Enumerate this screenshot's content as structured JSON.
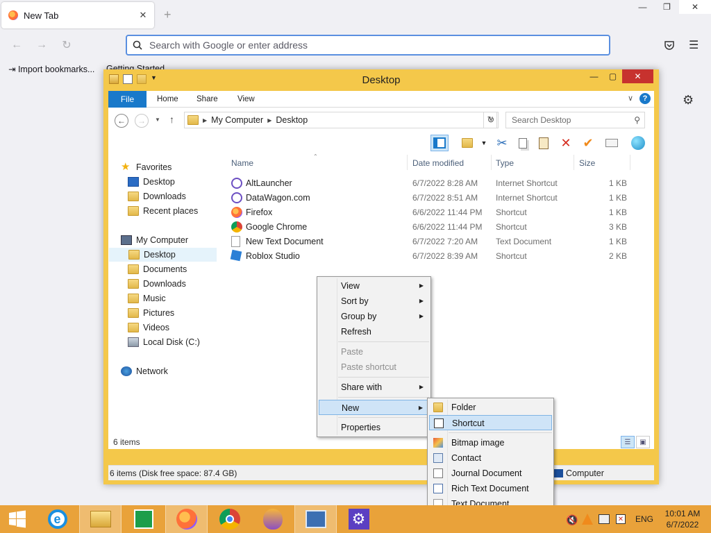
{
  "browser": {
    "tab_title": "New Tab",
    "tab_close": "✕",
    "newtab": "+",
    "url_placeholder": "Search with Google or enter address",
    "bookmarks": [
      "Import bookmarks...",
      "Getting Started"
    ]
  },
  "explorer": {
    "title": "Desktop",
    "ribbon_tabs": [
      "File",
      "Home",
      "Share",
      "View"
    ],
    "breadcrumb": [
      "My Computer",
      "Desktop"
    ],
    "search_placeholder": "Search Desktop",
    "nav": {
      "favorites": "Favorites",
      "fav_items": [
        "Desktop",
        "Downloads",
        "Recent places"
      ],
      "computer": "My Computer",
      "comp_items": [
        "Desktop",
        "Documents",
        "Downloads",
        "Music",
        "Pictures",
        "Videos",
        "Local Disk (C:)"
      ],
      "network": "Network"
    },
    "columns": [
      "Name",
      "Date modified",
      "Type",
      "Size"
    ],
    "files": [
      {
        "name": "AltLauncher",
        "date": "6/7/2022 8:28 AM",
        "type": "Internet Shortcut",
        "size": "1 KB"
      },
      {
        "name": "DataWagon.com",
        "date": "6/7/2022 8:51 AM",
        "type": "Internet Shortcut",
        "size": "1 KB"
      },
      {
        "name": "Firefox",
        "date": "6/6/2022 11:44 PM",
        "type": "Shortcut",
        "size": "1 KB"
      },
      {
        "name": "Google Chrome",
        "date": "6/6/2022 11:44 PM",
        "type": "Shortcut",
        "size": "3 KB"
      },
      {
        "name": "New Text Document",
        "date": "6/7/2022 7:20 AM",
        "type": "Text Document",
        "size": "1 KB"
      },
      {
        "name": "Roblox Studio",
        "date": "6/7/2022 8:39 AM",
        "type": "Shortcut",
        "size": "2 KB"
      }
    ],
    "item_count": "6 items",
    "status_left": "6 items (Disk free space: 87.4 GB)",
    "status_right": "Computer"
  },
  "context_menu": {
    "items": [
      "View",
      "Sort by",
      "Group by",
      "Refresh",
      "Paste",
      "Paste shortcut",
      "Share with",
      "New",
      "Properties"
    ]
  },
  "new_submenu": {
    "items": [
      "Folder",
      "Shortcut",
      "Bitmap image",
      "Contact",
      "Journal Document",
      "Rich Text Document",
      "Text Document"
    ]
  },
  "taskbar": {
    "lang": "ENG",
    "time": "10:01 AM",
    "date": "6/7/2022"
  },
  "colors": {
    "explorer_frame": "#f4c84a",
    "taskbar": "#e9a23a",
    "accent": "#1979ca",
    "close_red": "#c7322e"
  }
}
